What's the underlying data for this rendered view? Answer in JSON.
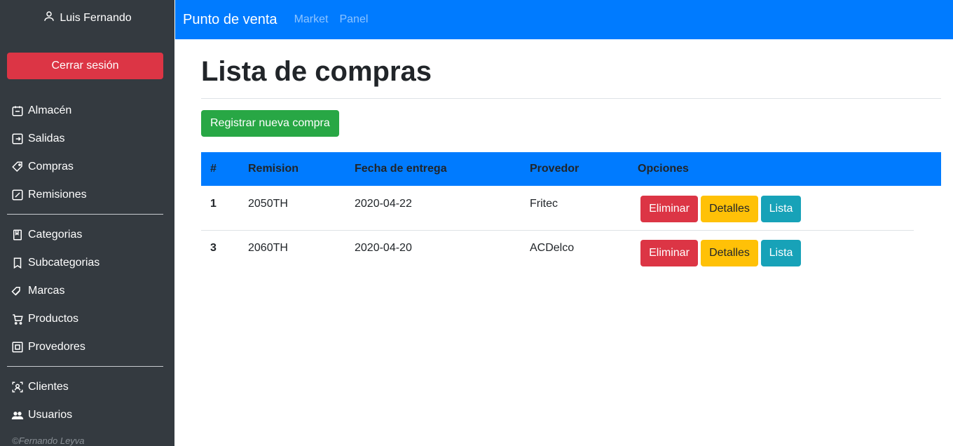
{
  "sidebar": {
    "user_name": "Luis Fernando",
    "logout_label": "Cerrar sesión",
    "items": [
      {
        "label": "Almacén",
        "icon": "calendar-box-icon"
      },
      {
        "label": "Salidas",
        "icon": "exit-box-icon"
      },
      {
        "label": "Compras",
        "icon": "tag-icon"
      },
      {
        "label": "Remisiones",
        "icon": "edit-box-icon"
      },
      {
        "label": "Categorias",
        "icon": "book-icon"
      },
      {
        "label": "Subcategorias",
        "icon": "bookmark-icon"
      },
      {
        "label": "Marcas",
        "icon": "tags-icon"
      },
      {
        "label": "Productos",
        "icon": "cart-icon"
      },
      {
        "label": "Provedores",
        "icon": "vendor-box-icon"
      },
      {
        "label": "Clientes",
        "icon": "person-frame-icon"
      },
      {
        "label": "Usuarios",
        "icon": "people-icon"
      }
    ],
    "footer": "©Fernando Leyva"
  },
  "navbar": {
    "brand": "Punto de venta",
    "links": [
      "Market",
      "Panel"
    ]
  },
  "main": {
    "title": "Lista de compras",
    "new_button": "Registrar nueva compra",
    "table": {
      "headers": [
        "#",
        "Remision",
        "Fecha de entrega",
        "Provedor",
        "Opciones"
      ],
      "rows": [
        {
          "num": "1",
          "remision": "2050TH",
          "fecha": "2020-04-22",
          "provedor": "Fritec"
        },
        {
          "num": "3",
          "remision": "2060TH",
          "fecha": "2020-04-20",
          "provedor": "ACDelco"
        }
      ],
      "actions": {
        "delete": "Eliminar",
        "details": "Detalles",
        "list": "Lista"
      }
    }
  },
  "colors": {
    "primary": "#007bff",
    "sidebar": "#343a40",
    "danger": "#dc3545",
    "success": "#28a745",
    "warning": "#ffc107",
    "info": "#17a2b8"
  }
}
